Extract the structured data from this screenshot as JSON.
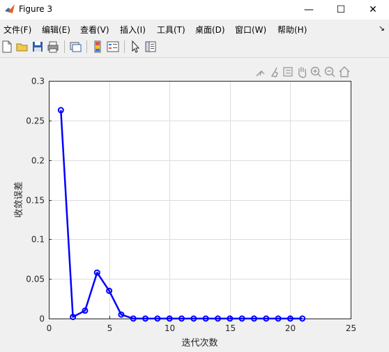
{
  "window": {
    "title": "Figure 3",
    "controls": {
      "minimize": "—",
      "maximize": "☐",
      "close": "✕"
    }
  },
  "menu": {
    "items": [
      "文件(F)",
      "编辑(E)",
      "查看(V)",
      "插入(I)",
      "工具(T)",
      "桌面(D)",
      "窗口(W)",
      "帮助(H)"
    ],
    "pin": "↘"
  },
  "toolbar": {
    "icons": [
      "new-figure-icon",
      "open-file-icon",
      "save-icon",
      "print-icon",
      "link-plot-icon",
      "insert-colorbar-icon",
      "insert-legend-icon",
      "pointer-icon",
      "property-inspector-icon"
    ]
  },
  "axes_toolbar": {
    "icons": [
      "export-icon",
      "brush-icon",
      "data-tips-icon",
      "pan-icon",
      "zoom-in-icon",
      "zoom-out-icon",
      "home-icon"
    ]
  },
  "colors": {
    "line": "#0000ff",
    "grid": "#dcdcdc",
    "axes_bg": "#ffffff"
  },
  "chart_data": {
    "type": "line",
    "xlabel": "迭代次数",
    "ylabel": "收敛误差",
    "xlim": [
      0,
      25
    ],
    "ylim": [
      0,
      0.3
    ],
    "xticks": [
      "0",
      "5",
      "10",
      "15",
      "20",
      "25"
    ],
    "yticks": [
      "0",
      "0.05",
      "0.1",
      "0.15",
      "0.2",
      "0.25",
      "0.3"
    ],
    "grid": true,
    "marker": "circle",
    "series": [
      {
        "x": [
          1,
          2,
          3,
          4,
          5,
          6,
          7,
          8,
          9,
          10,
          11,
          12,
          13,
          14,
          15,
          16,
          17,
          18,
          19,
          20,
          21
        ],
        "values": [
          0.263,
          0.002,
          0.01,
          0.058,
          0.035,
          0.005,
          0.0,
          0.0,
          0.0,
          0.0,
          0.0,
          0.0,
          0.0,
          0.0,
          0.0,
          0.0,
          0.0,
          0.0,
          0.0,
          0.0,
          0.0
        ]
      }
    ]
  }
}
